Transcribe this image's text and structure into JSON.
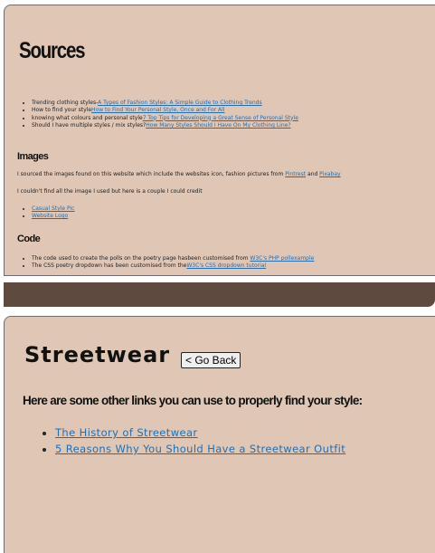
{
  "sources": {
    "title": "Sources",
    "list": [
      {
        "text": "Trending clothing styles-",
        "link": "A Types of Fashion Styles: A Simple Guide to Clothing Trends"
      },
      {
        "text": "How to find your style",
        "link": "How to Find Your Personal Style, Once and For All"
      },
      {
        "text": "knowing what colours and personal style",
        "link": "7 Top Tips for Developing a Great Sense of Personal Style"
      },
      {
        "text": "Should I have multiple styles / mix styles?",
        "link": "How Many Styles Should I Have On My Clothing Line?"
      }
    ],
    "images": {
      "heading": "Images",
      "para_before": "I sourced the images found on this website which include the websites icon, fashion pictures from ",
      "link1": "Pintrest",
      "and": " and ",
      "link2": "Pixabay",
      "para2": "I couldn't find all the image I used but here is a couple I could credit",
      "links": [
        "Casual Style Pic",
        "Website Logo"
      ]
    },
    "code": {
      "heading": "Code",
      "items": [
        {
          "text": "The code used to create the polls on the poetry page hasbeen customised from ",
          "link": "W3C's PHP pollexample"
        },
        {
          "text": "The CSS poetry dropdown has been customised from the",
          "link": "W3C's CSS dropdown tutorial"
        }
      ]
    }
  },
  "streetwear": {
    "title": "Streetwear",
    "back_button": "< Go Back",
    "subtitle": "Here are some other links you can use to properly find your style:",
    "links": [
      "The History of Streetwear",
      "5 Reasons Why You Should Have a Streetwear Outfit"
    ]
  },
  "colors": {
    "panel_bg": "#e0c6b5",
    "footer_bar": "#5e4a3f",
    "link": "#1f6fb5"
  }
}
